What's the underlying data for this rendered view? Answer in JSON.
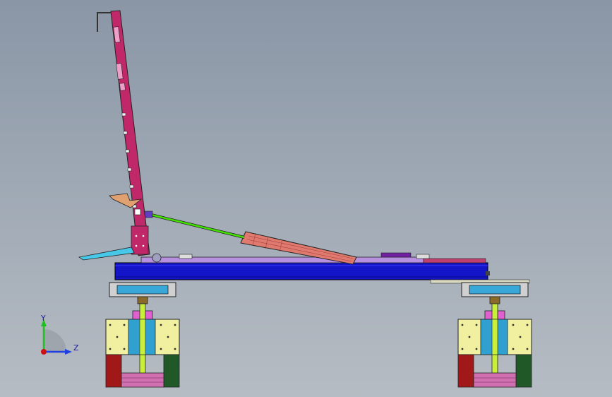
{
  "viewport": {
    "background_top": "#8a96a6",
    "background_bottom": "#b6bcc3"
  },
  "triad": {
    "y_label": "Y",
    "z_label": "Z",
    "y_color": "#1fbf1f",
    "z_color": "#1f3fe0",
    "x_color": "#d01010"
  },
  "model_colors": {
    "base_blue": "#1414c8",
    "arm_magenta": "#c0286a",
    "rod_green": "#43e000",
    "cylinder_salmon": "#e07a6e",
    "plate_purple": "#a070d0",
    "cyan_pad": "#38a8d8",
    "yellow_block": "#f0f0a0",
    "column_lime": "#c8f03a",
    "leg_red": "#a01818",
    "leg_green": "#205828",
    "leg_pink": "#d070b0"
  }
}
